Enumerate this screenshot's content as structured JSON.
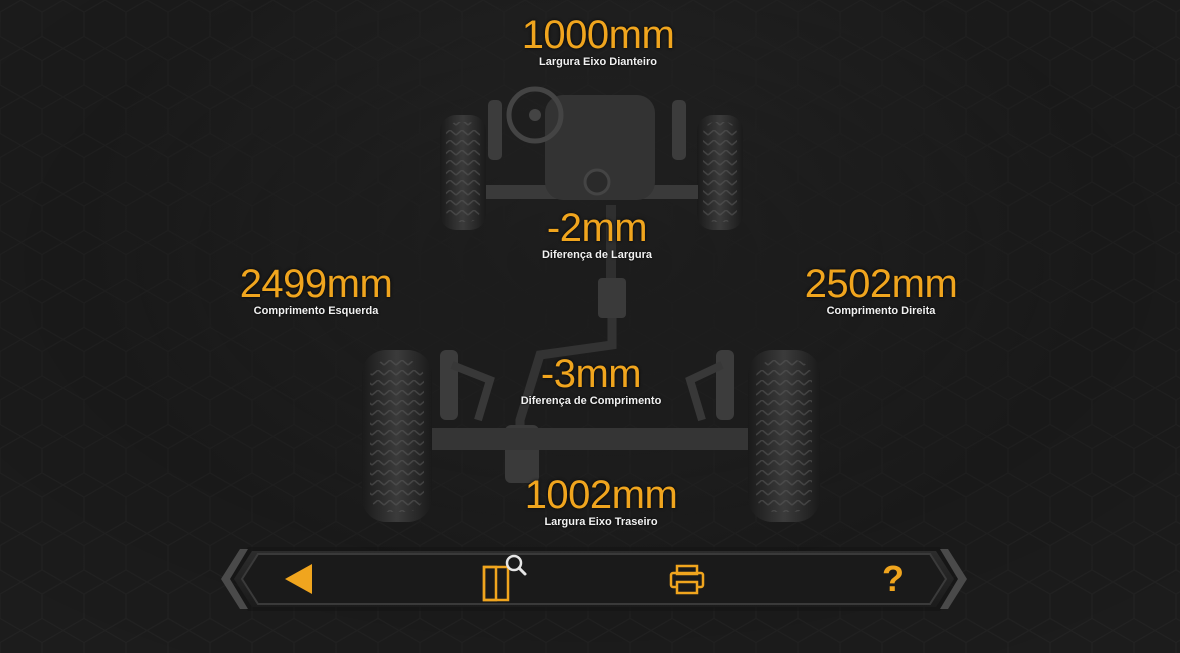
{
  "measurements": {
    "front_width": {
      "value": "1000mm",
      "label": "Largura Eixo Dianteiro"
    },
    "width_difference": {
      "value": "-2mm",
      "label": "Diferença de Largura"
    },
    "left_length": {
      "value": "2499mm",
      "label": "Comprimento Esquerda"
    },
    "right_length": {
      "value": "2502mm",
      "label": "Comprimento Direita"
    },
    "length_difference": {
      "value": "-3mm",
      "label": "Diferença de Comprimento"
    },
    "rear_width": {
      "value": "1002mm",
      "label": "Largura Eixo Traseiro"
    }
  },
  "toolbar": {
    "buttons": [
      {
        "icon": "back-arrow-icon"
      },
      {
        "icon": "report-preview-icon"
      },
      {
        "icon": "printer-icon"
      },
      {
        "icon": "help-icon",
        "label": "?"
      }
    ],
    "accent_color": "#f0a51e"
  },
  "colors": {
    "background": "#1c1c1c",
    "value_text": "#f0a51e",
    "label_text": "#f2f2f2"
  }
}
